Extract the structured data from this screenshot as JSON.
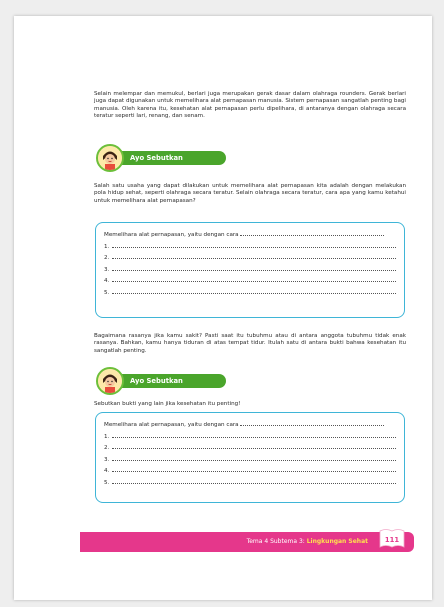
{
  "paragraph1": "Selain melempar dan memukul, berlari juga merupakan gerak dasar dalam olahraga rounders. Gerak berlari juga dapat digunakan untuk memelihara alat pernapasan manusia. Sistem pernapasan sangatlah penting bagi manusia. Oleh karena itu, kesehatan alat pernapasan perlu dipelihara, di antaranya dengan olahraga secara teratur seperti lari, renang, dan senam.",
  "section1": {
    "badge_label": "Ayo Sebutkan",
    "instruction": "Salah satu usaha yang dapat dilakukan untuk memelihara alat pernapasan kita adalah dengan melakukan pola hidup sehat, seperti olahraga secara teratur. Selain olahraga secara teratur, cara apa yang kamu ketahui untuk memelihara alat pernapasan?",
    "box_lead": "Memelihara alat pernapasan, yaitu dengan cara",
    "numbers": [
      "1.",
      "2.",
      "3.",
      "4.",
      "5."
    ]
  },
  "paragraph2": "Bagaimana rasanya jika kamu sakit? Pasti saat itu tubuhmu atau di antara anggota tubuhmu tidak enak rasanya. Bahkan, kamu hanya tiduran di atas tempat tidur. Itulah satu di antara bukti bahwa kesehatan itu sangatlah penting.",
  "section2": {
    "badge_label": "Ayo Sebutkan",
    "instruction": "Sebutkan bukti yang lain jika kesehatan itu penting!",
    "box_lead": "Memelihara alat pernapasan, yaitu dengan cara",
    "numbers": [
      "1.",
      "2.",
      "3.",
      "4.",
      "5."
    ]
  },
  "footer": {
    "theme": "Tema 4 Subtema 3:",
    "subtheme": "Lingkungan Sehat",
    "page_number": "111"
  },
  "colors": {
    "accent_pink": "#e5378b",
    "badge_green": "#4aa52b",
    "box_blue": "#3fb5d7"
  },
  "icons": {
    "badge_avatar": "girl-pointing-icon",
    "page_tab": "page-tab-icon"
  }
}
